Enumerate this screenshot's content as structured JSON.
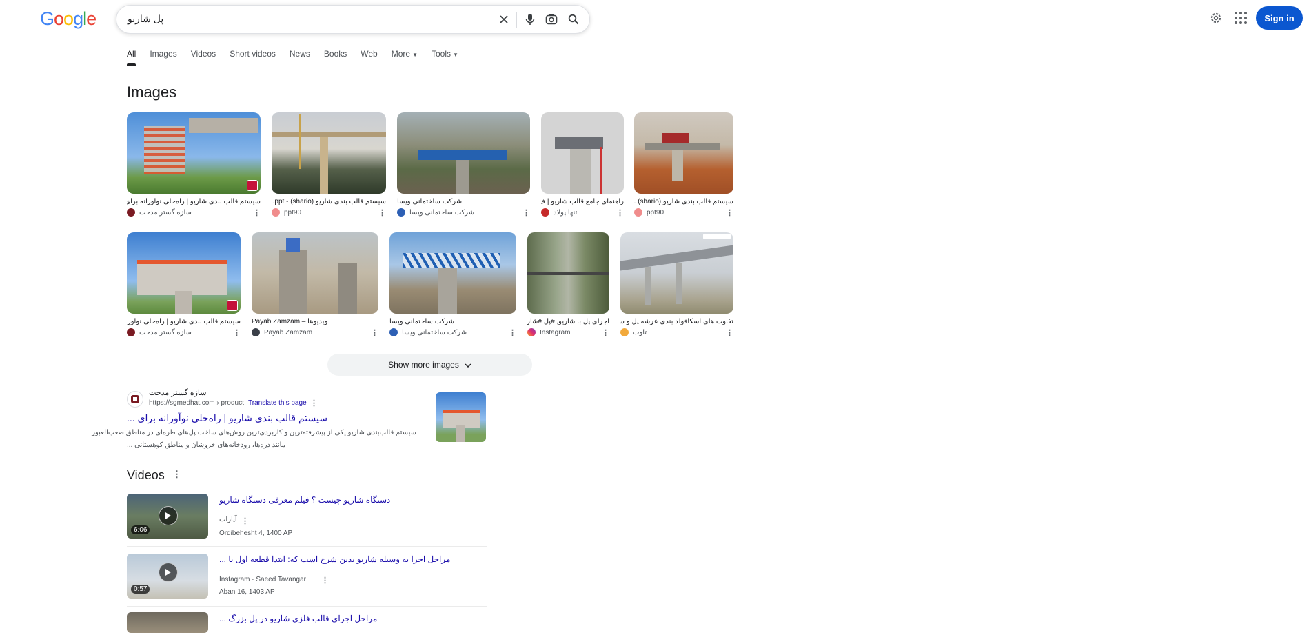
{
  "header": {
    "logo": [
      "G",
      "o",
      "o",
      "g",
      "l",
      "e"
    ],
    "logo_colors": [
      "#4285f4",
      "#ea4335",
      "#fbbc05",
      "#4285f4",
      "#34a853",
      "#ea4335"
    ],
    "query": "پل شاریو",
    "signin_label": "Sign in"
  },
  "tabs": [
    {
      "label": "All",
      "active": true
    },
    {
      "label": "Images"
    },
    {
      "label": "Videos"
    },
    {
      "label": "Short videos"
    },
    {
      "label": "News"
    },
    {
      "label": "Books"
    },
    {
      "label": "Web"
    },
    {
      "label": "More",
      "dropdown": true
    },
    {
      "label": "Tools",
      "dropdown": true
    }
  ],
  "images": {
    "title": "Images",
    "row1": [
      {
        "title": "سیستم قالب بندی شاریو | راه‌حلی نوآورانه برای سا...",
        "source": "سازه گستر مدحت"
      },
      {
        "title": "سیستم قالب بندی شاریو (shario) - ppt...",
        "source": "ppt90"
      },
      {
        "title": "شرکت ساختمانی ویسا",
        "source": "شرکت ساختمانی ویسا"
      },
      {
        "title": "راهنمای جامع قالب شاریو | ف...",
        "source": "تنها پولاد"
      },
      {
        "title": "سیستم قالب بندی شاریو (shario) ...",
        "source": "ppt90"
      }
    ],
    "row2": [
      {
        "title": "سیستم قالب بندی شاریو | راه‌حلی نوآورانه بر...",
        "source": "سازه گستر مدحت"
      },
      {
        "title": "ویدیوها – Payab Zamzam",
        "source": "Payab Zamzam"
      },
      {
        "title": "شرکت ساختمانی ویسا",
        "source": "شرکت ساختمانی ویسا"
      },
      {
        "title": "اجرای پل با شاریو, #پل #شار...",
        "source": "Instagram"
      },
      {
        "title": "تفاوت های اسکافولد بندی عرشه پل و سیستم...",
        "source": "تاوب"
      }
    ],
    "show_more": "Show more images"
  },
  "result": {
    "site_name": "سازه گستر مدحت",
    "url": "https://sgmedhat.com › product",
    "translate": "Translate this page",
    "title": "سیستم قالب بندی شاریو | راه‌حلی نوآورانه برای ...",
    "snippet_line1": "سیستم قالب‌بندی شاریو یکی از پیشرفته‌ترین و کاربردی‌ترین روش‌های ساخت پل‌های طره‌ای در مناطق صعب‌العبور",
    "snippet_line2": "مانند دره‌ها، رودخانه‌های خروشان و مناطق کوهستانی ..."
  },
  "videos": {
    "title": "Videos",
    "items": [
      {
        "title": "دستگاه شاریو چیست ؟ فیلم معرفی دستگاه شاریو",
        "duration": "6:06",
        "source": "آپارات",
        "date": "Ordibehesht 4, 1400 AP"
      },
      {
        "title": "مراحل اجرا به وسیله شاریو بدین شرح است که: ابتدا قطعه اول با ...",
        "duration": "0:57",
        "source": "Instagram · Saeed Tavangar",
        "date": "Aban 16, 1403 AP"
      },
      {
        "title": "مراحل اجرای قالب فلزی شاریو در پل بزرگ ...",
        "duration": "",
        "source": "",
        "date": ""
      }
    ]
  }
}
